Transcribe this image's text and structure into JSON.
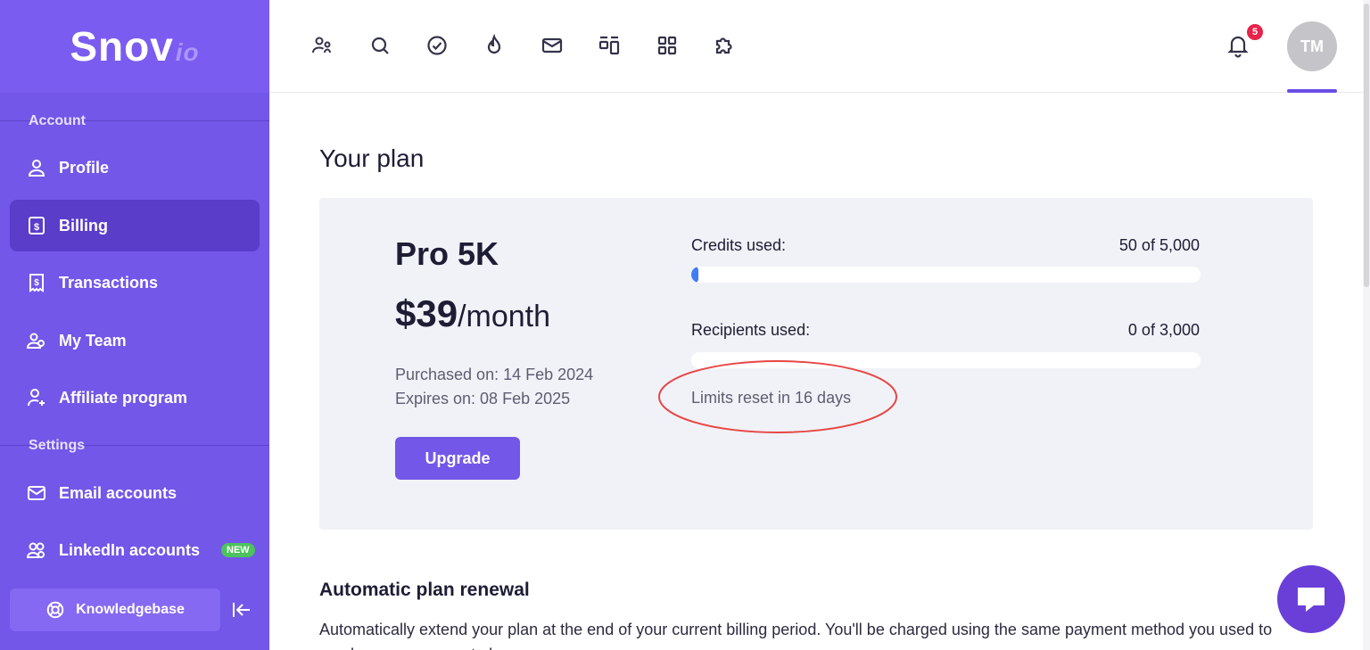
{
  "brand": {
    "name": "Snov",
    "suffix": "io"
  },
  "sidebar": {
    "account_label": "Account",
    "settings_label": "Settings",
    "items": [
      {
        "label": "Profile",
        "icon": "user-icon"
      },
      {
        "label": "Billing",
        "icon": "dollar-document-icon",
        "active": true
      },
      {
        "label": "Transactions",
        "icon": "receipt-icon"
      },
      {
        "label": "My Team",
        "icon": "team-icon"
      },
      {
        "label": "Affiliate program",
        "icon": "user-plus-icon"
      },
      {
        "label": "Email accounts",
        "icon": "envelope-icon"
      },
      {
        "label": "LinkedIn accounts",
        "icon": "users-icon",
        "badge": "NEW"
      }
    ],
    "knowledgebase_label": "Knowledgebase"
  },
  "topbar": {
    "icons": [
      "prospects-icon",
      "search-icon",
      "check-circle-icon",
      "fire-icon",
      "mail-icon",
      "pipeline-icon",
      "apps-grid-icon",
      "puzzle-icon"
    ],
    "notification_count": "5",
    "avatar_initials": "TM"
  },
  "main": {
    "title": "Your plan",
    "plan": {
      "name": "Pro 5K",
      "price": "$39",
      "period": "/month",
      "purchased": "Purchased on: 14 Feb 2024",
      "expires": "Expires on: 08 Feb 2025",
      "upgrade_label": "Upgrade"
    },
    "usage": {
      "credits_label": "Credits used:",
      "credits_value": "50 of 5,000",
      "credits_fraction": 0.01,
      "recipients_label": "Recipients used:",
      "recipients_value": "0 of 3,000",
      "recipients_fraction": 0,
      "reset_text": "Limits reset in 16 days"
    },
    "renewal": {
      "title": "Automatic plan renewal",
      "description": "Automatically extend your plan at the end of your current billing period. You'll be charged using the same payment method you used to purchase your current plan."
    }
  },
  "colors": {
    "sidebar": "#7257e8",
    "sidebar_active": "#5a3dc9",
    "accent": "#7257e8",
    "progress": "#3f7cf5",
    "annotation": "#e84545",
    "notification": "#e8234a"
  }
}
